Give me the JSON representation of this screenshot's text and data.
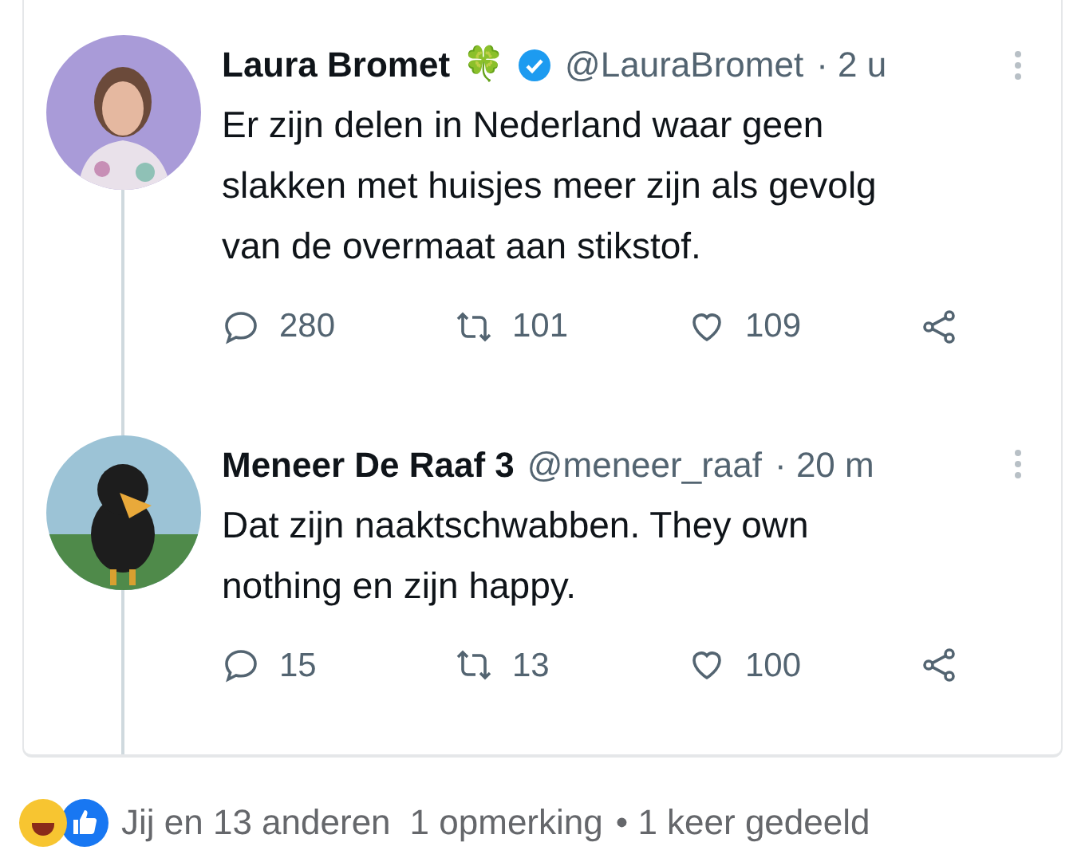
{
  "tweets": [
    {
      "name": "Laura Bromet",
      "badge_emoji": "🍀",
      "verified": true,
      "handle": "@LauraBromet",
      "time": "· 2 u",
      "text": "Er zijn delen in Nederland waar geen slakken met huisjes meer zijn als gevolg van de overmaat aan stikstof.",
      "replies": "280",
      "retweets": "101",
      "likes": "109"
    },
    {
      "name": "Meneer De Raaf 3",
      "verified": false,
      "handle": "@meneer_raaf",
      "time": "· 20 m",
      "text": "Dat zijn naaktschwabben. They own nothing en zijn happy.",
      "replies": "15",
      "retweets": "13",
      "likes": "100"
    }
  ],
  "footer": {
    "reactions": "Jij en 13 anderen",
    "comments": "1 opmerking",
    "shares": "• 1 keer gedeeld"
  }
}
